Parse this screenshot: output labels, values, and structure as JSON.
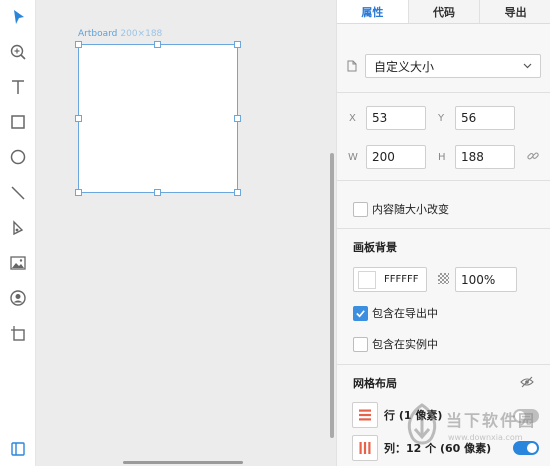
{
  "toolbar": {
    "tools": [
      {
        "name": "select-tool",
        "icon": "arrow-pointer-icon"
      },
      {
        "name": "zoom-tool",
        "icon": "zoom-in-icon"
      },
      {
        "name": "text-tool",
        "icon": "text-icon"
      },
      {
        "name": "rectangle-tool",
        "icon": "rectangle-icon"
      },
      {
        "name": "ellipse-tool",
        "icon": "ellipse-icon"
      },
      {
        "name": "line-tool",
        "icon": "line-icon"
      },
      {
        "name": "pen-tool",
        "icon": "pen-icon"
      },
      {
        "name": "image-tool",
        "icon": "image-icon"
      },
      {
        "name": "symbol-tool",
        "icon": "avatar-circle-icon"
      },
      {
        "name": "artboard-tool",
        "icon": "artboard-icon"
      }
    ],
    "bottom_icon": "panel-icon"
  },
  "canvas": {
    "artboard_name": "Artboard",
    "artboard_dims": "200×188"
  },
  "panel": {
    "tabs": [
      {
        "label": "属性",
        "active": true
      },
      {
        "label": "代码",
        "active": false
      },
      {
        "label": "导出",
        "active": false
      }
    ],
    "size_preset": "自定义大小",
    "x_label": "X",
    "x_value": "53",
    "y_label": "Y",
    "y_value": "56",
    "w_label": "W",
    "w_value": "200",
    "h_label": "H",
    "h_value": "188",
    "resize_content_label": "内容随大小改变",
    "resize_content_checked": false,
    "background_title": "画板背景",
    "background_color": "FFFFFF",
    "background_opacity": "100%",
    "include_export_label": "包含在导出中",
    "include_export_checked": true,
    "include_instance_label": "包含在实例中",
    "include_instance_checked": false,
    "grid_title": "网格布局",
    "grid_rows_label": "行 (1 像素)",
    "grid_rows_enabled": false,
    "grid_cols_label": "列：12 个 (60 像素)",
    "grid_cols_enabled": true
  },
  "watermark": {
    "text": "当下软件园",
    "url": "www.downxia.com"
  },
  "colors": {
    "accent": "#2a7ad6",
    "artboard_border": "#6aa7dd",
    "canvas_bg": "#ececec",
    "grid_icon": "#e8624a"
  }
}
